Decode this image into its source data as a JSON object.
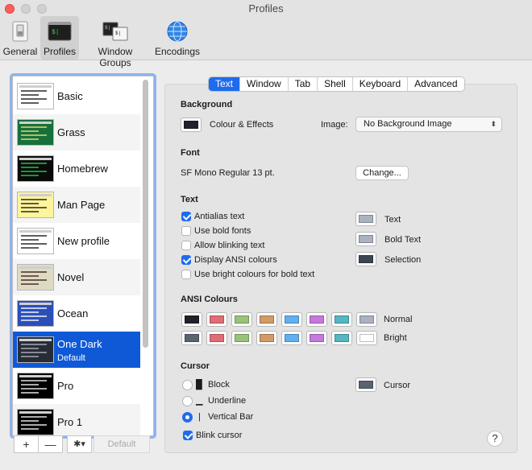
{
  "window": {
    "title": "Profiles"
  },
  "toolbar": {
    "items": [
      {
        "label": "General",
        "icon": "switch-icon"
      },
      {
        "label": "Profiles",
        "icon": "terminal-icon",
        "selected": true
      },
      {
        "label": "Window Groups",
        "icon": "window-groups-icon"
      },
      {
        "label": "Encodings",
        "icon": "globe-icon"
      }
    ]
  },
  "sidebar": {
    "profiles": [
      {
        "name": "Basic",
        "bg": "#ffffff",
        "fg": "#1a1a1a"
      },
      {
        "name": "Grass",
        "bg": "#16703a",
        "fg": "#e9e27b"
      },
      {
        "name": "Homebrew",
        "bg": "#0a0a0a",
        "fg": "#21d342"
      },
      {
        "name": "Man Page",
        "bg": "#fef49c",
        "fg": "#1a1a1a"
      },
      {
        "name": "New profile",
        "bg": "#ffffff",
        "fg": "#1a1a1a"
      },
      {
        "name": "Novel",
        "bg": "#dfdbc3",
        "fg": "#3b2322"
      },
      {
        "name": "Ocean",
        "bg": "#2b4fb8",
        "fg": "#ffffff"
      },
      {
        "name": "One Dark",
        "bg": "#282c34",
        "fg": "#abb2bf",
        "selected": true,
        "default_label": "Default"
      },
      {
        "name": "Pro",
        "bg": "#000000",
        "fg": "#f2f2f2"
      },
      {
        "name": "Pro 1",
        "bg": "#000000",
        "fg": "#f2f2f2"
      }
    ],
    "add_label": "+",
    "remove_label": "—",
    "gear_label": "✱▾",
    "default_label": "Default"
  },
  "tabs": [
    "Text",
    "Window",
    "Tab",
    "Shell",
    "Keyboard",
    "Advanced"
  ],
  "background": {
    "heading": "Background",
    "colour_effects": "Colour & Effects",
    "swatch": "#1f2228",
    "image_label": "Image:",
    "image_value": "No Background Image"
  },
  "font": {
    "heading": "Font",
    "value": "SF Mono Regular 13 pt.",
    "change_label": "Change..."
  },
  "text": {
    "heading": "Text",
    "options": [
      {
        "label": "Antialias text",
        "checked": true
      },
      {
        "label": "Use bold fonts",
        "checked": false
      },
      {
        "label": "Allow blinking text",
        "checked": false
      },
      {
        "label": "Display ANSI colours",
        "checked": true
      },
      {
        "label": "Use bright colours for bold text",
        "checked": false
      }
    ],
    "colours": [
      {
        "label": "Text",
        "color": "#abb2bf"
      },
      {
        "label": "Bold Text",
        "color": "#abb2bf"
      },
      {
        "label": "Selection",
        "color": "#3e4451"
      }
    ]
  },
  "ansi": {
    "heading": "ANSI Colours",
    "normal_label": "Normal",
    "bright_label": "Bright",
    "normal": [
      "#1f2228",
      "#e06c75",
      "#98c379",
      "#d19a66",
      "#61afef",
      "#c678dd",
      "#56b6c2",
      "#abb2bf"
    ],
    "bright": [
      "#5c6370",
      "#e06c75",
      "#98c379",
      "#d19a66",
      "#61afef",
      "#c678dd",
      "#56b6c2",
      "#ffffff"
    ]
  },
  "cursor": {
    "heading": "Cursor",
    "options": [
      {
        "glyph": "█",
        "label": "Block",
        "selected": false
      },
      {
        "glyph": "▁",
        "label": "Underline",
        "selected": false
      },
      {
        "glyph": "|",
        "label": "Vertical Bar",
        "selected": true
      }
    ],
    "blink_label": "Blink cursor",
    "blink_checked": true,
    "colour_label": "Cursor",
    "colour": "#5c6370"
  },
  "help_label": "?"
}
